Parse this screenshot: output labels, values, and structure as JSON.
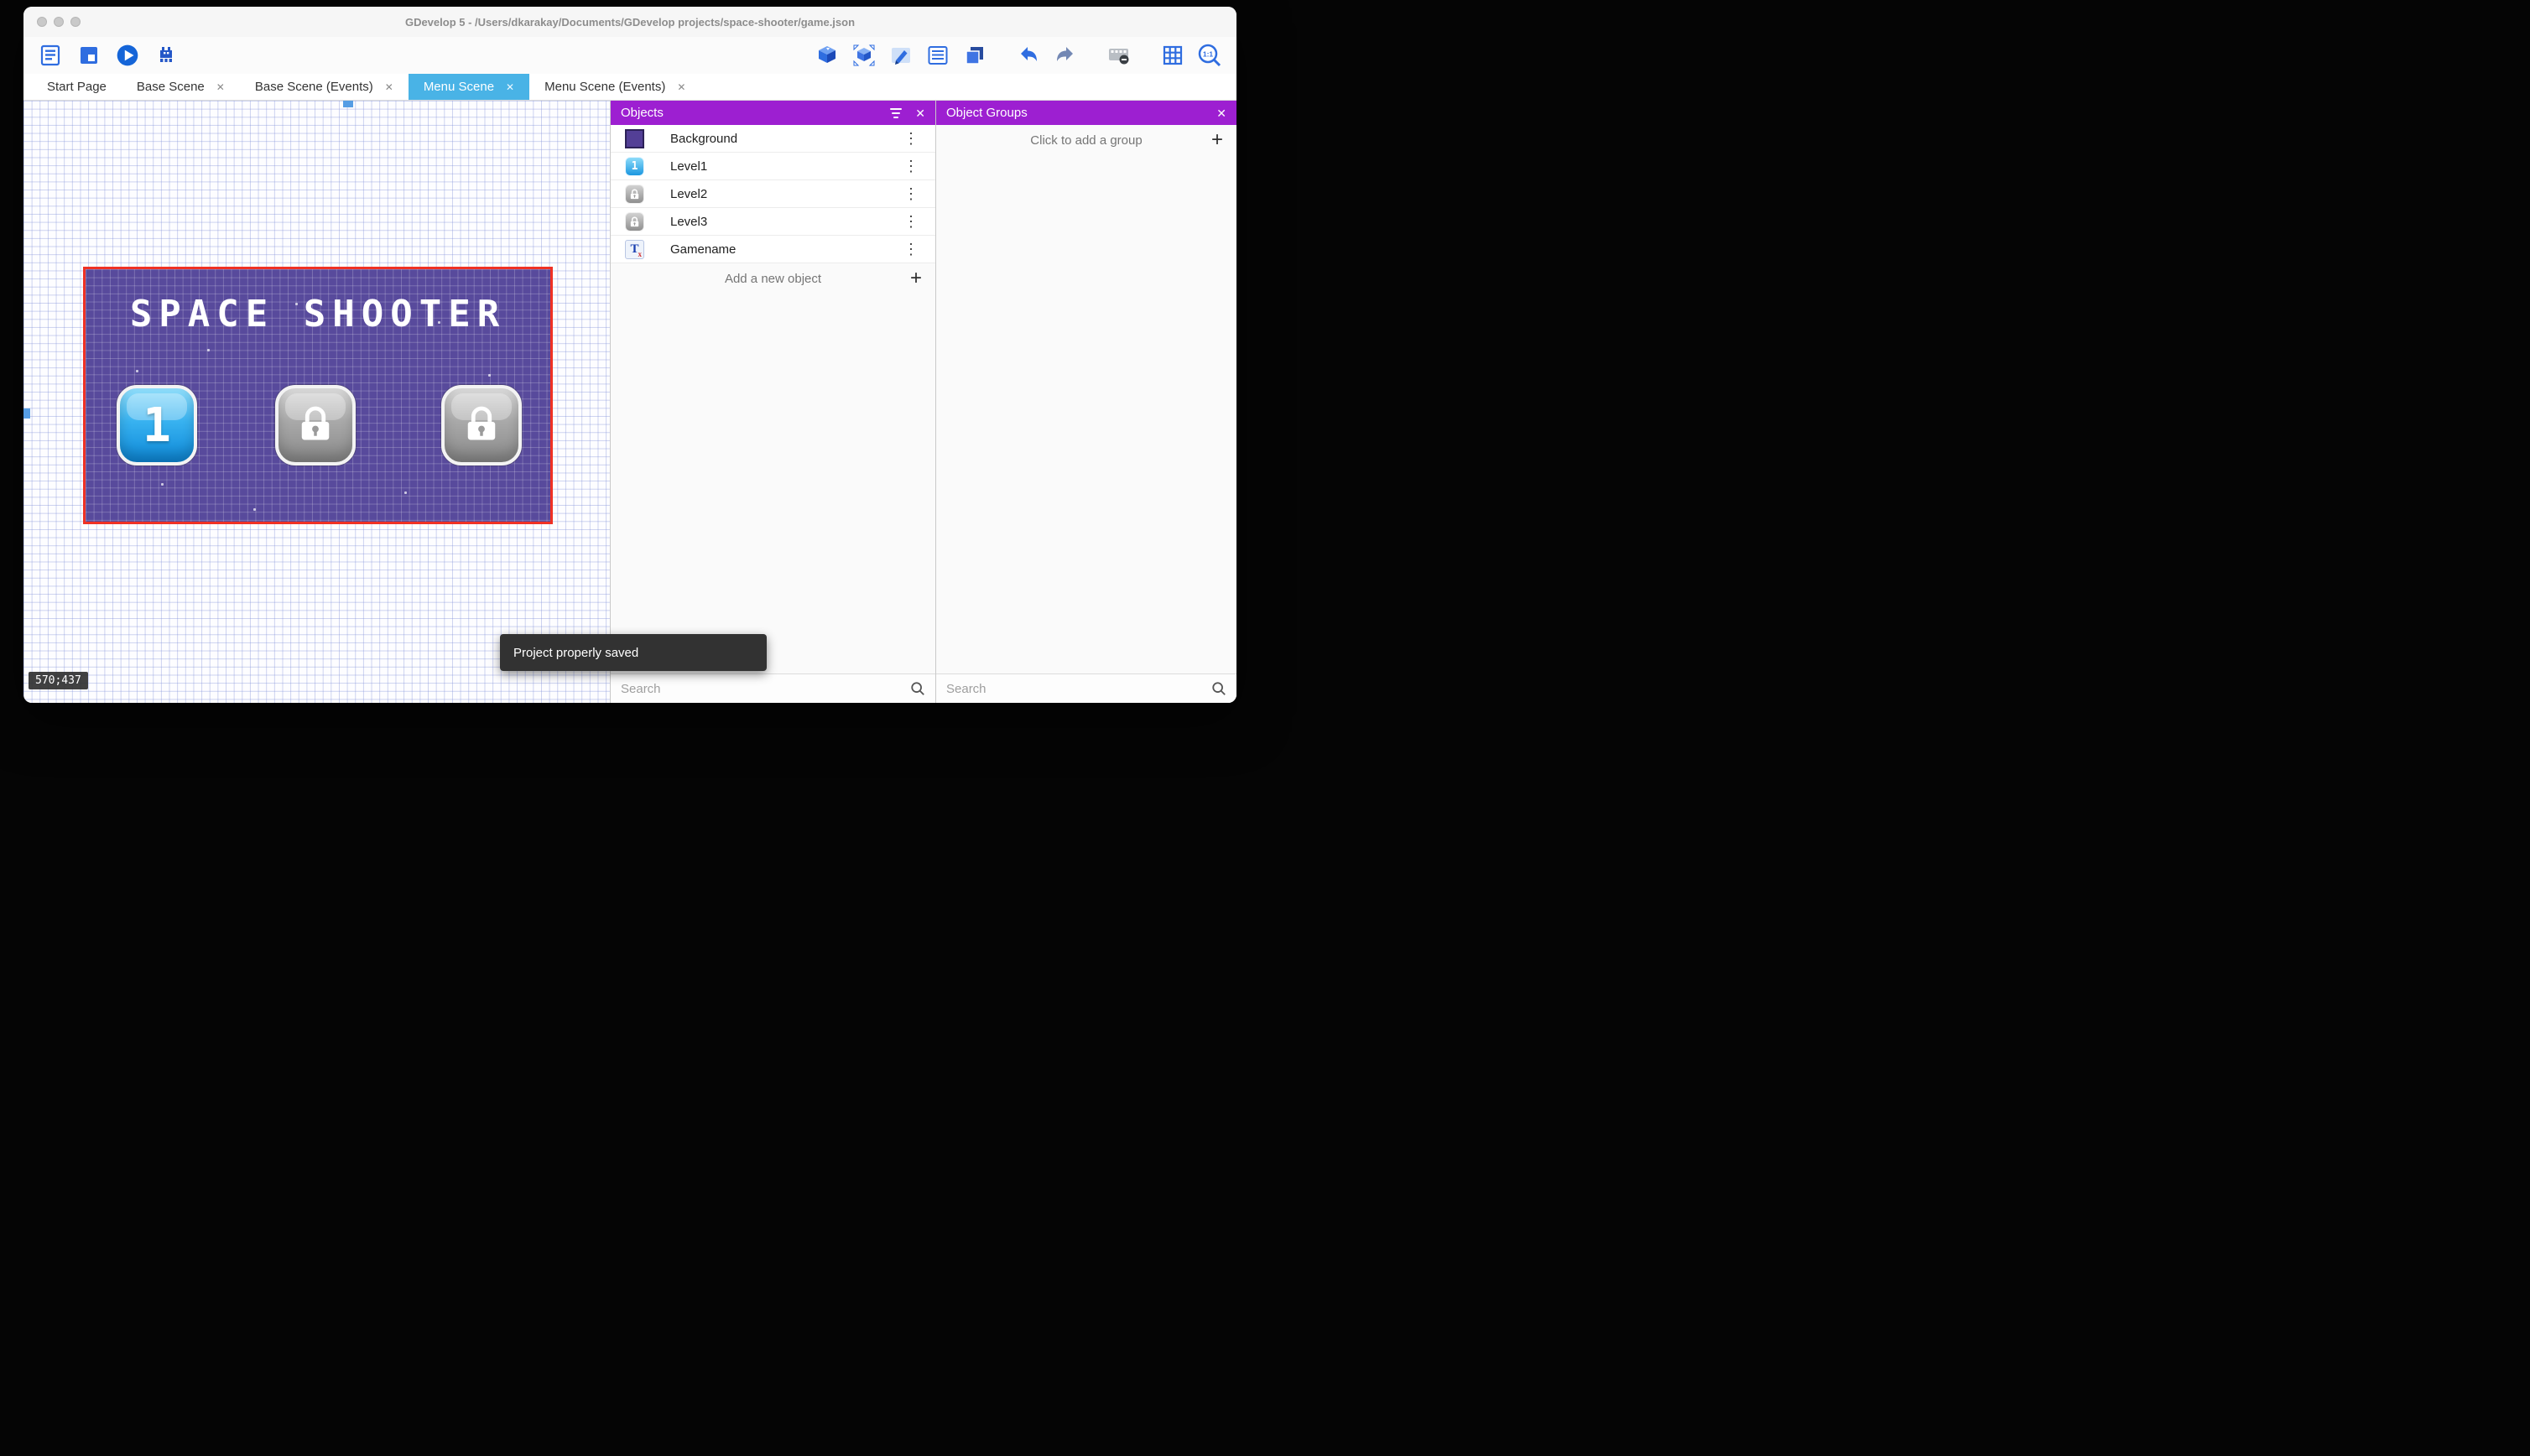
{
  "colors": {
    "panel_header": "#9d1fd1",
    "active_tab": "#49b3e6",
    "selection_border": "#ef3124",
    "scene_background": "#584a9c",
    "toolbar_icon_blue": "#2f6de0",
    "toast_background": "#323232"
  },
  "window": {
    "title": "GDevelop 5 - /Users/dkarakay/Documents/GDevelop projects/space-shooter/game.json"
  },
  "tabs": [
    {
      "label": "Start Page"
    },
    {
      "label": "Base Scene"
    },
    {
      "label": "Base Scene (Events)"
    },
    {
      "label": "Menu Scene"
    },
    {
      "label": "Menu Scene (Events)"
    }
  ],
  "icons": {
    "close": "✕",
    "add": "+",
    "more": "⋮"
  },
  "toolbar": {
    "zoom_label": "1:1"
  },
  "canvas": {
    "coordinates": "570;437",
    "scene_title": "SPACE SHOOTER",
    "level1_label": "1"
  },
  "toast": {
    "message": "Project properly saved"
  },
  "objects_panel": {
    "title": "Objects",
    "items": [
      {
        "name": "Background"
      },
      {
        "name": "Level1"
      },
      {
        "name": "Level2"
      },
      {
        "name": "Level3"
      },
      {
        "name": "Gamename"
      }
    ],
    "add_label": "Add a new object",
    "search_placeholder": "Search",
    "text_icon": "T",
    "text_icon_sub": "x"
  },
  "object_groups_panel": {
    "title": "Object Groups",
    "add_label": "Click to add a group",
    "search_placeholder": "Search"
  }
}
